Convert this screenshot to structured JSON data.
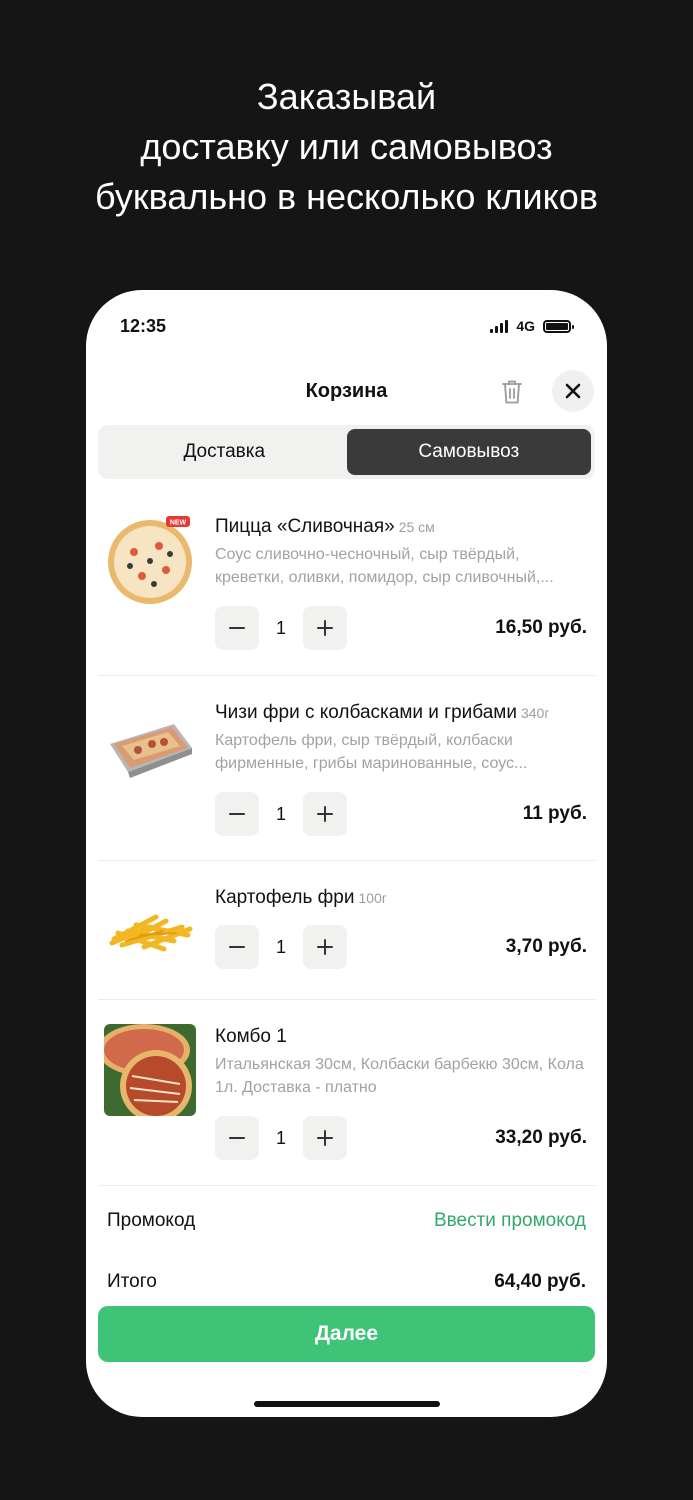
{
  "promo": {
    "line1": "Заказывай",
    "line2": "доставку или самовывоз",
    "line3": "буквально в несколько кликов"
  },
  "status_bar": {
    "time": "12:35",
    "network": "4G"
  },
  "header": {
    "title": "Корзина",
    "icons": {
      "trash": "trash-icon",
      "close": "close-icon"
    }
  },
  "tabs": [
    {
      "label": "Доставка",
      "active": false
    },
    {
      "label": "Самовывоз",
      "active": true
    }
  ],
  "cart_items": [
    {
      "name": "Пицца «Сливочная»",
      "weight": "25 см",
      "description": "Соус сливочно-чесночный, сыр твёрдый, креветки, оливки, помидор, сыр сливочный,...",
      "quantity": "1",
      "price": "16,50 руб.",
      "badge": "NEW"
    },
    {
      "name": "Чизи фри с колбасками и грибами",
      "weight": "340г",
      "description": "Картофель фри, сыр твёрдый, колбаски фирменные, грибы маринованные, соус...",
      "quantity": "1",
      "price": "11 руб."
    },
    {
      "name": "Картофель фри",
      "weight": "100г",
      "description": "",
      "quantity": "1",
      "price": "3,70 руб."
    },
    {
      "name": "Комбо 1",
      "weight": "",
      "description": "Итальянская 30см, Колбаски барбекю 30см, Кола 1л. Доставка - платно",
      "quantity": "1",
      "price": "33,20 руб."
    }
  ],
  "promo_code": {
    "label": "Промокод",
    "link": "Ввести промокод"
  },
  "total": {
    "label": "Итого",
    "value": "64,40 руб."
  },
  "next_button": "Далее",
  "colors": {
    "accent": "#3fc377",
    "link": "#2fa96a",
    "active_tab": "#3a3a3a",
    "background": "#151515"
  }
}
